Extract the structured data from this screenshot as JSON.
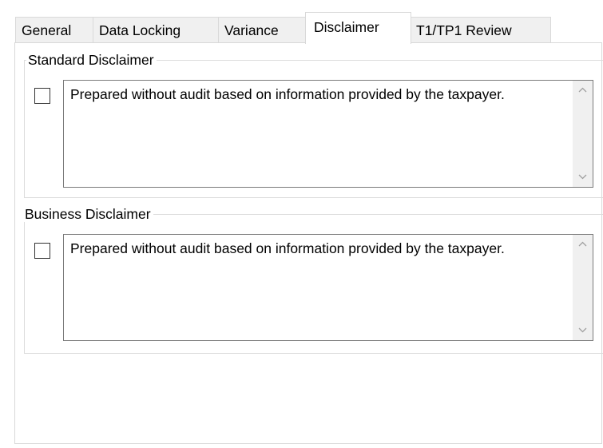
{
  "tabs": [
    {
      "label": "General",
      "active": false
    },
    {
      "label": "Data Locking",
      "active": false
    },
    {
      "label": "Variance",
      "active": false
    },
    {
      "label": "Disclaimer",
      "active": true
    },
    {
      "label": "T1/TP1 Review",
      "active": false
    }
  ],
  "standard_disclaimer": {
    "title": "Standard Disclaimer",
    "checked": false,
    "text": "Prepared without audit based on information provided by the taxpayer."
  },
  "business_disclaimer": {
    "title": "Business Disclaimer",
    "checked": false,
    "text": "Prepared without audit based on information provided by the taxpayer."
  },
  "icons": {
    "scroll_up": "chevron-up-icon",
    "scroll_down": "chevron-down-icon"
  },
  "colors": {
    "tab_inactive_bg": "#f0f0f0",
    "tab_active_bg": "#ffffff",
    "border": "#d9d9d9",
    "textarea_border": "#7a7a7a",
    "scrollbar_track": "#f0f0f0",
    "scroll_arrow": "#a0a0a0"
  }
}
